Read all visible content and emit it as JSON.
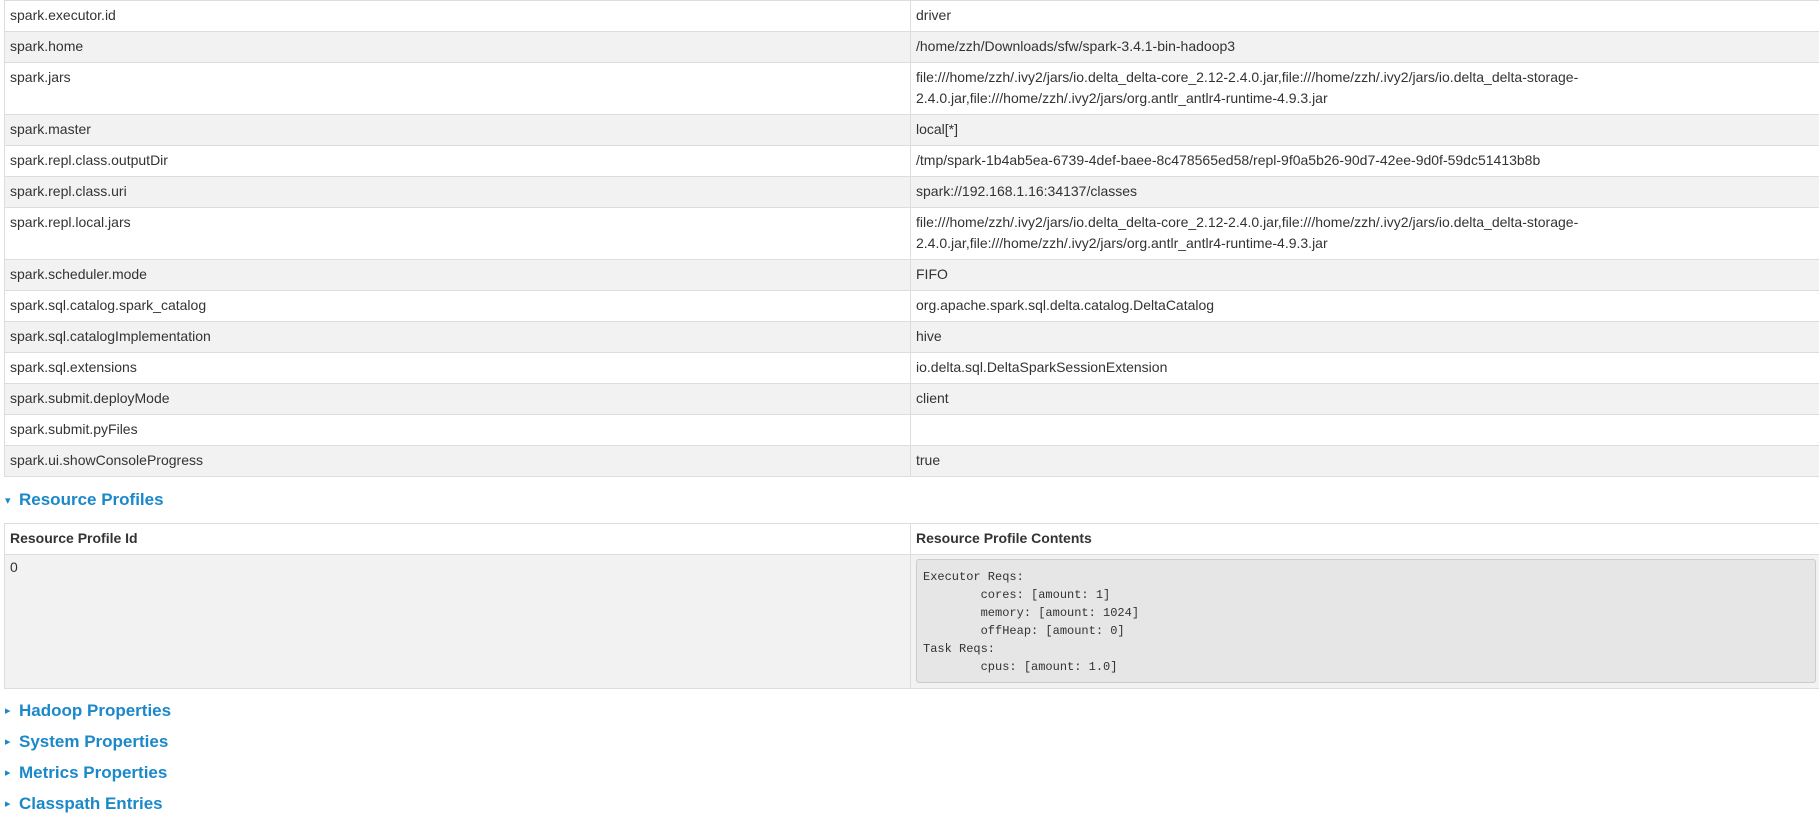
{
  "properties": [
    {
      "name": "spark.executor.id",
      "value": "driver"
    },
    {
      "name": "spark.home",
      "value": "/home/zzh/Downloads/sfw/spark-3.4.1-bin-hadoop3"
    },
    {
      "name": "spark.jars",
      "value": "file:///home/zzh/.ivy2/jars/io.delta_delta-core_2.12-2.4.0.jar,file:///home/zzh/.ivy2/jars/io.delta_delta-storage-2.4.0.jar,file:///home/zzh/.ivy2/jars/org.antlr_antlr4-runtime-4.9.3.jar"
    },
    {
      "name": "spark.master",
      "value": "local[*]"
    },
    {
      "name": "spark.repl.class.outputDir",
      "value": "/tmp/spark-1b4ab5ea-6739-4def-baee-8c478565ed58/repl-9f0a5b26-90d7-42ee-9d0f-59dc51413b8b"
    },
    {
      "name": "spark.repl.class.uri",
      "value": "spark://192.168.1.16:34137/classes"
    },
    {
      "name": "spark.repl.local.jars",
      "value": "file:///home/zzh/.ivy2/jars/io.delta_delta-core_2.12-2.4.0.jar,file:///home/zzh/.ivy2/jars/io.delta_delta-storage-2.4.0.jar,file:///home/zzh/.ivy2/jars/org.antlr_antlr4-runtime-4.9.3.jar"
    },
    {
      "name": "spark.scheduler.mode",
      "value": "FIFO"
    },
    {
      "name": "spark.sql.catalog.spark_catalog",
      "value": "org.apache.spark.sql.delta.catalog.DeltaCatalog"
    },
    {
      "name": "spark.sql.catalogImplementation",
      "value": "hive"
    },
    {
      "name": "spark.sql.extensions",
      "value": "io.delta.sql.DeltaSparkSessionExtension"
    },
    {
      "name": "spark.submit.deployMode",
      "value": "client"
    },
    {
      "name": "spark.submit.pyFiles",
      "value": ""
    },
    {
      "name": "spark.ui.showConsoleProgress",
      "value": "true"
    }
  ],
  "resource_profiles": {
    "title": "Resource Profiles",
    "col_id": "Resource Profile Id",
    "col_contents": "Resource Profile Contents",
    "rows": [
      {
        "id": "0",
        "contents": "Executor Reqs:\n\tcores: [amount: 1]\n\tmemory: [amount: 1024]\n\toffHeap: [amount: 0]\nTask Reqs:\n\tcpus: [amount: 1.0]"
      }
    ]
  },
  "collapsed_sections": [
    "Hadoop Properties",
    "System Properties",
    "Metrics Properties",
    "Classpath Entries"
  ],
  "colors": {
    "accent": "#1a88c9",
    "row_alt": "#f2f2f2"
  }
}
